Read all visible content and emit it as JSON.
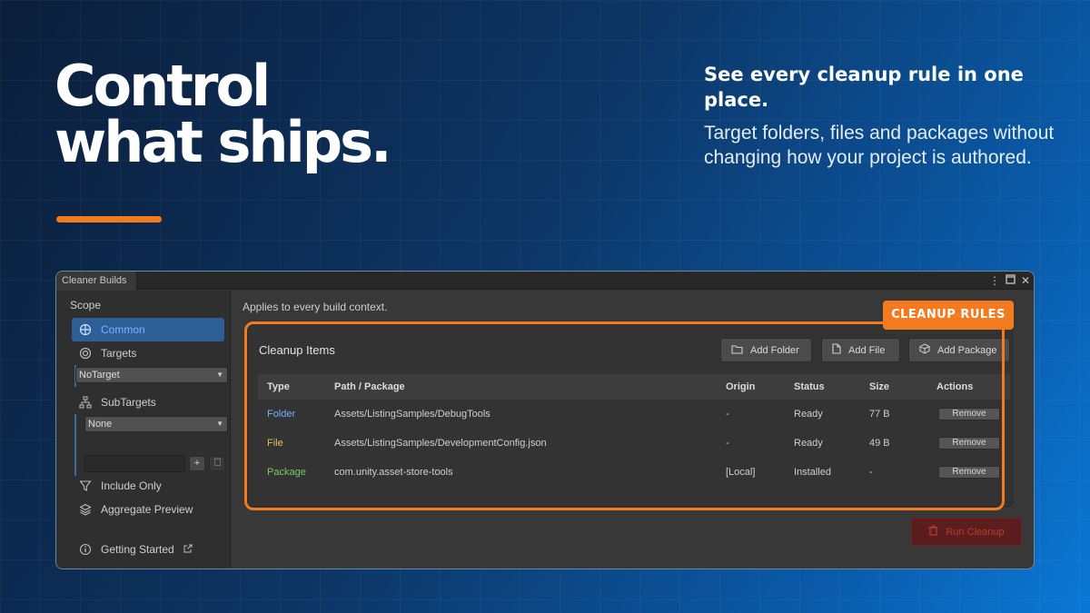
{
  "hero": {
    "line1": "Control",
    "line2": "what ships.",
    "accent_color": "#f47a20"
  },
  "tagline": "See every cleanup rule in one place.",
  "subtext": "Target folders, files and packages without changing how your project is authored.",
  "window": {
    "tab_title": "Cleaner Builds",
    "icons": [
      "more-vert-icon",
      "maximize-icon",
      "close-icon"
    ]
  },
  "sidebar": {
    "scope_label": "Scope",
    "items": [
      {
        "label": "Common",
        "icon": "globe-icon",
        "active": true
      },
      {
        "label": "Targets",
        "icon": "target-icon"
      },
      {
        "label": "SubTargets",
        "icon": "hierarchy-icon"
      },
      {
        "label": "Include Only",
        "icon": "filter-icon"
      },
      {
        "label": "Aggregate Preview",
        "icon": "layers-icon"
      },
      {
        "label": "Getting Started",
        "icon": "info-icon"
      }
    ],
    "targets_value": "NoTarget",
    "subtargets_value": "None",
    "add_label": "+",
    "delete_icon": "trash-icon"
  },
  "main": {
    "hint": "Applies to every build context.",
    "badge": "CLEANUP RULES",
    "panel_title": "Cleanup Items",
    "buttons": {
      "add_folder": "Add Folder",
      "add_file": "Add File",
      "add_package": "Add Package"
    },
    "columns": [
      "Type",
      "Path / Package",
      "Origin",
      "Status",
      "Size",
      "Actions"
    ],
    "rows": [
      {
        "type": "Folder",
        "type_color": "#6fb3ff",
        "path": "Assets/ListingSamples/DebugTools",
        "origin": "-",
        "status": "Ready",
        "size": "77 B",
        "action": "Remove"
      },
      {
        "type": "File",
        "type_color": "#e8c25a",
        "path": "Assets/ListingSamples/DevelopmentConfig.json",
        "origin": "-",
        "status": "Ready",
        "size": "49 B",
        "action": "Remove"
      },
      {
        "type": "Package",
        "type_color": "#7cc86a",
        "path": "com.unity.asset-store-tools",
        "origin": "[Local]",
        "status": "Installed",
        "size": "-",
        "action": "Remove"
      }
    ],
    "run_label": "Run Cleanup"
  }
}
